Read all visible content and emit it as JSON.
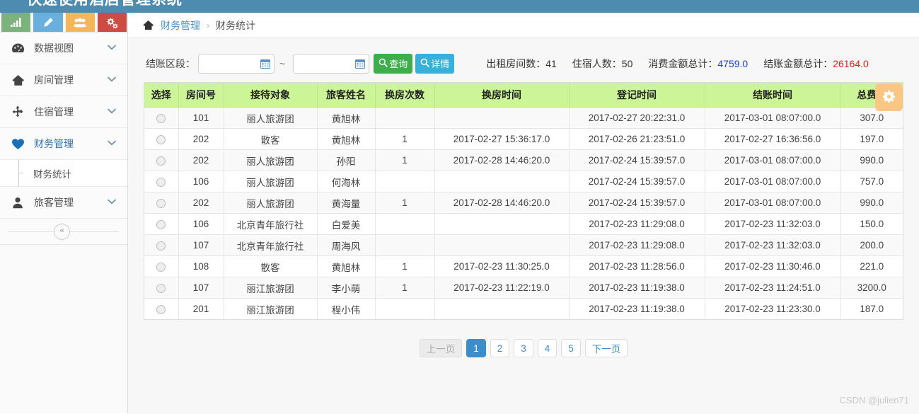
{
  "topbar": {
    "title": "快速使用酒店管理系统"
  },
  "quick_icons": [
    {
      "name": "chart-icon",
      "color": "#7cb37c"
    },
    {
      "name": "pencil-icon",
      "color": "#6ab0de"
    },
    {
      "name": "users-icon",
      "color": "#f5b65a"
    },
    {
      "name": "gears-icon",
      "color": "#cc4b42"
    }
  ],
  "sidebar": {
    "items": [
      {
        "label": "数据视图",
        "icon": "dashboard-icon",
        "active": false
      },
      {
        "label": "房间管理",
        "icon": "home-icon",
        "active": false
      },
      {
        "label": "住宿管理",
        "icon": "arrows-icon",
        "active": false
      },
      {
        "label": "财务管理",
        "icon": "heart-icon",
        "active": true
      },
      {
        "label": "旅客管理",
        "icon": "user-icon",
        "active": false
      }
    ],
    "submenu": [
      {
        "label": "财务统计"
      }
    ],
    "collapse_label": "«"
  },
  "breadcrumb": {
    "home_icon": "home-icon",
    "parent": "财务管理",
    "separator": "›",
    "current": "财务统计"
  },
  "toolbar": {
    "range_label": "结账区段：",
    "date_start_value": "",
    "date_end_value": "",
    "date_placeholder": "",
    "tilde": "~",
    "search_label": "查询",
    "detail_label": "详情",
    "gear_icon": "gear-icon"
  },
  "stats": [
    {
      "label": "出租房间数：",
      "value": "41",
      "color": "#333333"
    },
    {
      "label": "住宿人数：",
      "value": "50",
      "color": "#333333"
    },
    {
      "label": "消费金额总计：",
      "value": "4759.0",
      "color": "#1b40d8"
    },
    {
      "label": "结账金额总计：",
      "value": "26164.0",
      "color": "#e81b1b"
    }
  ],
  "table": {
    "headers": [
      "选择",
      "房间号",
      "接待对象",
      "旅客姓名",
      "换房次数",
      "换房时间",
      "登记时间",
      "结账时间",
      "总费用"
    ],
    "rows": [
      {
        "room": "101",
        "object": "丽人旅游团",
        "guest": "黄旭林",
        "swaps": "",
        "swap_time": "",
        "reg_time": "2017-02-27 20:22:31.0",
        "settle_time": "2017-03-01 08:07:00.0",
        "total": "307.0"
      },
      {
        "room": "202",
        "object": "散客",
        "guest": "黄旭林",
        "swaps": "1",
        "swap_time": "2017-02-27 15:36:17.0",
        "reg_time": "2017-02-26 21:23:51.0",
        "settle_time": "2017-02-27 16:36:56.0",
        "total": "197.0"
      },
      {
        "room": "202",
        "object": "丽人旅游团",
        "guest": "孙阳",
        "swaps": "1",
        "swap_time": "2017-02-28 14:46:20.0",
        "reg_time": "2017-02-24 15:39:57.0",
        "settle_time": "2017-03-01 08:07:00.0",
        "total": "990.0"
      },
      {
        "room": "106",
        "object": "丽人旅游团",
        "guest": "何海林",
        "swaps": "",
        "swap_time": "",
        "reg_time": "2017-02-24 15:39:57.0",
        "settle_time": "2017-03-01 08:07:00.0",
        "total": "757.0"
      },
      {
        "room": "202",
        "object": "丽人旅游团",
        "guest": "黄海量",
        "swaps": "1",
        "swap_time": "2017-02-28 14:46:20.0",
        "reg_time": "2017-02-24 15:39:57.0",
        "settle_time": "2017-03-01 08:07:00.0",
        "total": "990.0"
      },
      {
        "room": "106",
        "object": "北京青年旅行社",
        "guest": "白爱美",
        "swaps": "",
        "swap_time": "",
        "reg_time": "2017-02-23 11:29:08.0",
        "settle_time": "2017-02-23 11:32:03.0",
        "total": "150.0"
      },
      {
        "room": "107",
        "object": "北京青年旅行社",
        "guest": "周海风",
        "swaps": "",
        "swap_time": "",
        "reg_time": "2017-02-23 11:29:08.0",
        "settle_time": "2017-02-23 11:32:03.0",
        "total": "200.0"
      },
      {
        "room": "108",
        "object": "散客",
        "guest": "黄旭林",
        "swaps": "1",
        "swap_time": "2017-02-23 11:30:25.0",
        "reg_time": "2017-02-23 11:28:56.0",
        "settle_time": "2017-02-23 11:30:46.0",
        "total": "221.0"
      },
      {
        "room": "107",
        "object": "丽江旅游团",
        "guest": "李小萌",
        "swaps": "1",
        "swap_time": "2017-02-23 11:22:19.0",
        "reg_time": "2017-02-23 11:19:38.0",
        "settle_time": "2017-02-23 11:24:51.0",
        "total": "3200.0"
      },
      {
        "room": "201",
        "object": "丽江旅游团",
        "guest": "程小伟",
        "swaps": "",
        "swap_time": "",
        "reg_time": "2017-02-23 11:19:38.0",
        "settle_time": "2017-02-23 11:23:30.0",
        "total": "187.0"
      }
    ]
  },
  "pagination": {
    "prev_label": "上一页",
    "next_label": "下一页",
    "pages": [
      "1",
      "2",
      "3",
      "4",
      "5"
    ],
    "current": "1"
  },
  "watermark": "CSDN @julien71",
  "colors": {
    "topbar": "#4d8cb0",
    "table_header": "#ccf598",
    "accent": "#3c8dcc",
    "search_button": "#3eae4c",
    "detail_button": "#38b0da",
    "gear_button": "#fbc584"
  }
}
